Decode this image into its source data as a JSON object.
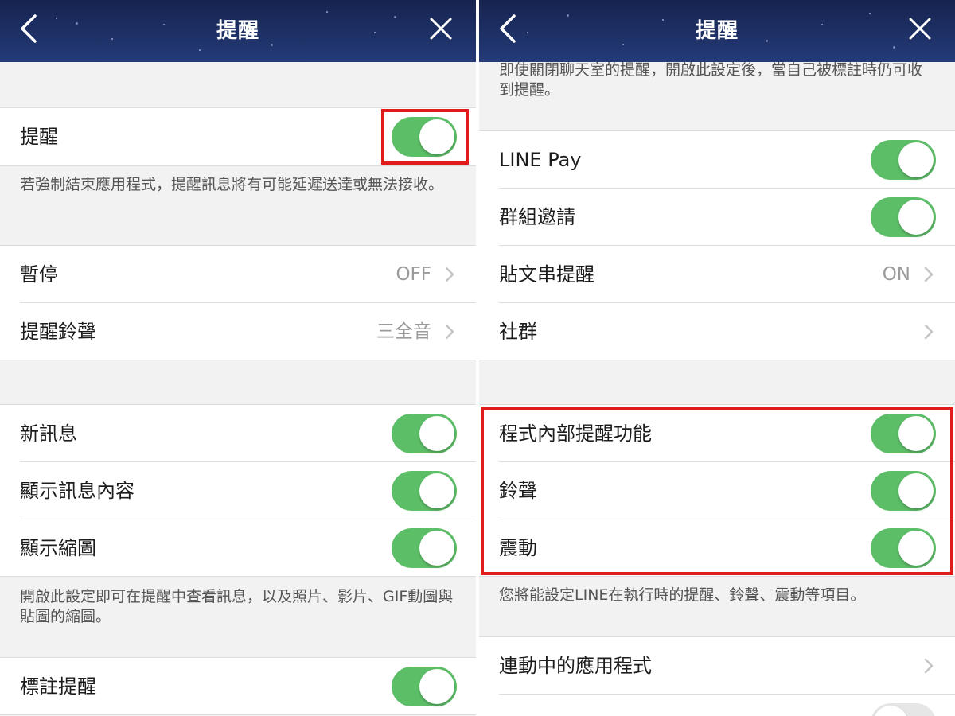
{
  "left": {
    "header": {
      "title": "提醒",
      "back_icon": "chevron-left-icon",
      "close_icon": "close-icon"
    },
    "notifications": {
      "label": "提醒",
      "on": true
    },
    "notifications_note": "若強制結束應用程式，提醒訊息將有可能延遲送達或無法接收。",
    "pause": {
      "label": "暫停",
      "value": "OFF"
    },
    "sound": {
      "label": "提醒鈴聲",
      "value": "三全音"
    },
    "new_message": {
      "label": "新訊息",
      "on": true
    },
    "show_content": {
      "label": "顯示訊息內容",
      "on": true
    },
    "show_thumbnail": {
      "label": "顯示縮圖",
      "on": true
    },
    "thumbnail_note": "開啟此設定即可在提醒中查看訊息，以及照片、影片、GIF動圖與貼圖的縮圖。",
    "mention": {
      "label": "標註提醒",
      "on": true
    }
  },
  "right": {
    "header": {
      "title": "提醒",
      "back_icon": "chevron-left-icon",
      "close_icon": "close-icon"
    },
    "mention_note": "即使關閉聊天室的提醒，開啟此設定後，當自己被標註時仍可收到提醒。",
    "line_pay": {
      "label": "LINE Pay",
      "on": true
    },
    "group_invite": {
      "label": "群組邀請",
      "on": true
    },
    "post_thread": {
      "label": "貼文串提醒",
      "value": "ON"
    },
    "community": {
      "label": "社群"
    },
    "in_app": {
      "label": "程式內部提醒功能",
      "on": true
    },
    "ringtone": {
      "label": "鈴聲",
      "on": true
    },
    "vibration": {
      "label": "震動",
      "on": true
    },
    "in_app_note": "您將能設定LINE在執行時的提醒、鈴聲、震動等項目。",
    "linked_apps": {
      "label": "連動中的應用程式"
    },
    "next_item": {
      "on": false
    }
  },
  "colors": {
    "toggle_on": "#5dbe68",
    "header_dark": "#16234f",
    "highlight": "#e01b1b"
  }
}
